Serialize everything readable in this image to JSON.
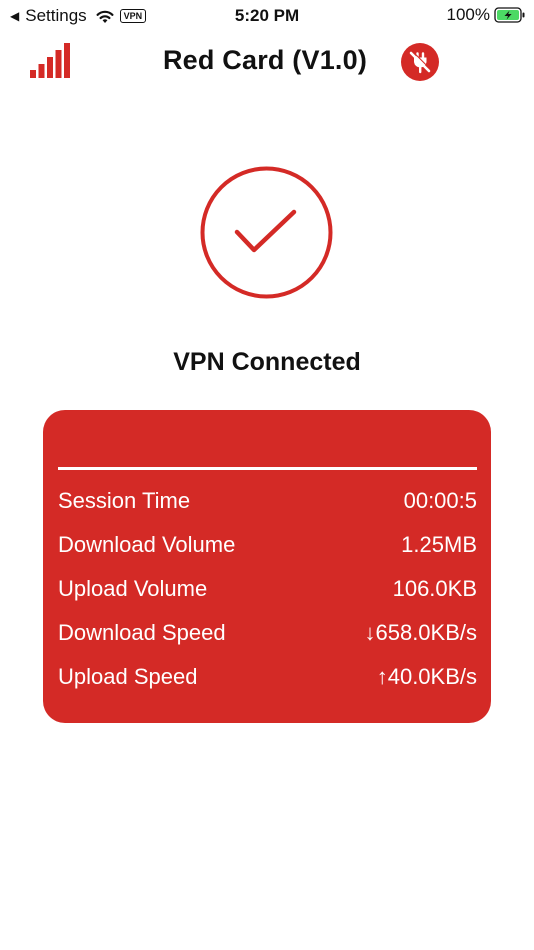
{
  "status_bar": {
    "back_label": "Settings",
    "vpn_badge": "VPN",
    "time": "5:20 PM",
    "battery_percent": "100%"
  },
  "header": {
    "title": "Red Card (V1.0)",
    "signal_bars": 5
  },
  "connection": {
    "status_text": "VPN Connected"
  },
  "stats": {
    "rows": [
      {
        "label": "Session Time",
        "value": "00:00:5"
      },
      {
        "label": "Download Volume",
        "value": "1.25MB"
      },
      {
        "label": "Upload Volume",
        "value": "106.0KB"
      },
      {
        "label": "Download Speed",
        "value": "↓658.0KB/s"
      },
      {
        "label": "Upload Speed",
        "value": "↑40.0KB/s"
      }
    ]
  },
  "colors": {
    "accent": "#d42a26",
    "battery_fill": "#4cd964",
    "card_text": "#ffffff"
  }
}
